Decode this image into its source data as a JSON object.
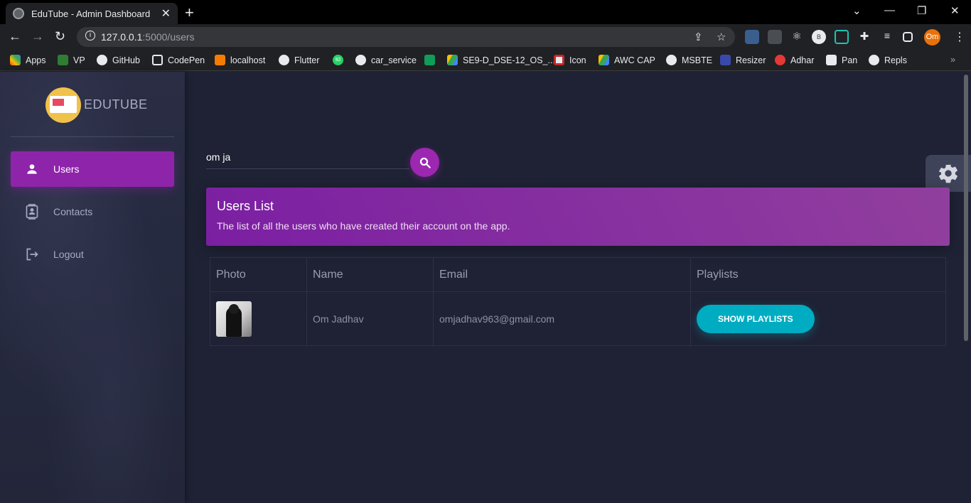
{
  "browser": {
    "tab_title": "EduTube - Admin Dashboard",
    "url_host": "127.0.0.1",
    "url_path": ":5000/users",
    "avatar_initials": "Om",
    "ext_b_label": "B"
  },
  "bookmarks": [
    {
      "label": "Apps"
    },
    {
      "label": "VP"
    },
    {
      "label": "GitHub"
    },
    {
      "label": "CodePen"
    },
    {
      "label": "localhost"
    },
    {
      "label": "Flutter"
    },
    {
      "label": "92"
    },
    {
      "label": "car_service"
    },
    {
      "label": ""
    },
    {
      "label": "SE9-D_DSE-12_OS_..."
    },
    {
      "label": "Icon"
    },
    {
      "label": "AWC CAP"
    },
    {
      "label": "MSBTE"
    },
    {
      "label": "Resizer"
    },
    {
      "label": "Adhar"
    },
    {
      "label": "Pan"
    },
    {
      "label": "Repls"
    }
  ],
  "sidebar": {
    "brand": "EDUTUBE",
    "items": [
      {
        "label": "Users",
        "icon": "person-icon",
        "active": true
      },
      {
        "label": "Contacts",
        "icon": "contacts-icon",
        "active": false
      },
      {
        "label": "Logout",
        "icon": "logout-icon",
        "active": false
      }
    ]
  },
  "search": {
    "value": "om ja"
  },
  "card": {
    "title": "Users List",
    "subtitle": "The list of all the users who have created their account on the app."
  },
  "table": {
    "headers": [
      "Photo",
      "Name",
      "Email",
      "Playlists"
    ],
    "rows": [
      {
        "name": "Om Jadhav",
        "email": "omjadhav963@gmail.com",
        "button": "SHOW PLAYLISTS"
      }
    ]
  },
  "colors": {
    "accent_purple": "#8e24aa",
    "accent_cyan": "#00acc1",
    "page_bg": "#1f2235"
  }
}
